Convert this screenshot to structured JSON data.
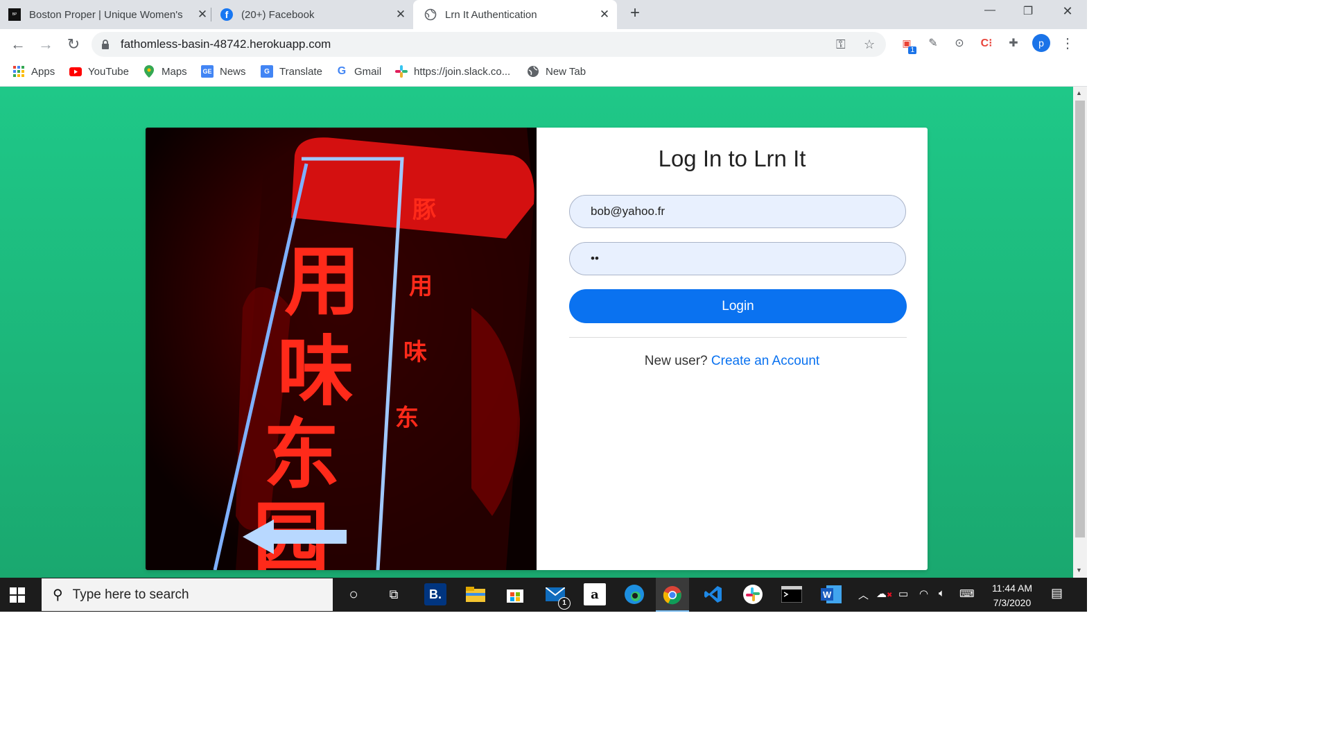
{
  "browser": {
    "tabs": [
      {
        "title": "Boston Proper | Unique Women's",
        "favicon": "boston-proper-icon",
        "active": false
      },
      {
        "title": "(20+) Facebook",
        "favicon": "facebook-icon",
        "active": false
      },
      {
        "title": "Lrn It Authentication",
        "favicon": "globe-icon",
        "active": true
      }
    ],
    "new_tab_label": "+",
    "url": "fathomless-basin-48742.herokuapp.com",
    "extension_badge": "1",
    "profile_initial": "p",
    "bookmarks": [
      {
        "label": "Apps",
        "icon": "apps-grid-icon"
      },
      {
        "label": "YouTube",
        "icon": "youtube-icon"
      },
      {
        "label": "Maps",
        "icon": "maps-pin-icon"
      },
      {
        "label": "News",
        "icon": "google-news-icon"
      },
      {
        "label": "Translate",
        "icon": "google-translate-icon"
      },
      {
        "label": "Gmail",
        "icon": "google-icon"
      },
      {
        "label": "https://join.slack.co...",
        "icon": "slack-icon"
      },
      {
        "label": "New Tab",
        "icon": "globe-icon"
      }
    ]
  },
  "login": {
    "title": "Log In to Lrn It",
    "email_value": "bob@yahoo.fr",
    "password_masked": "••",
    "login_button": "Login",
    "new_user_text": "New user?",
    "create_account_link": "Create an Account"
  },
  "colors": {
    "page_gradient_top": "#1fc888",
    "page_gradient_bottom": "#1aa86f",
    "primary_button": "#0a72f0",
    "link": "#0a72f0",
    "input_bg": "#e8f0fe"
  },
  "taskbar": {
    "search_placeholder": "Type here to search",
    "mail_badge": "1",
    "time": "11:44 AM",
    "date": "7/3/2020"
  }
}
